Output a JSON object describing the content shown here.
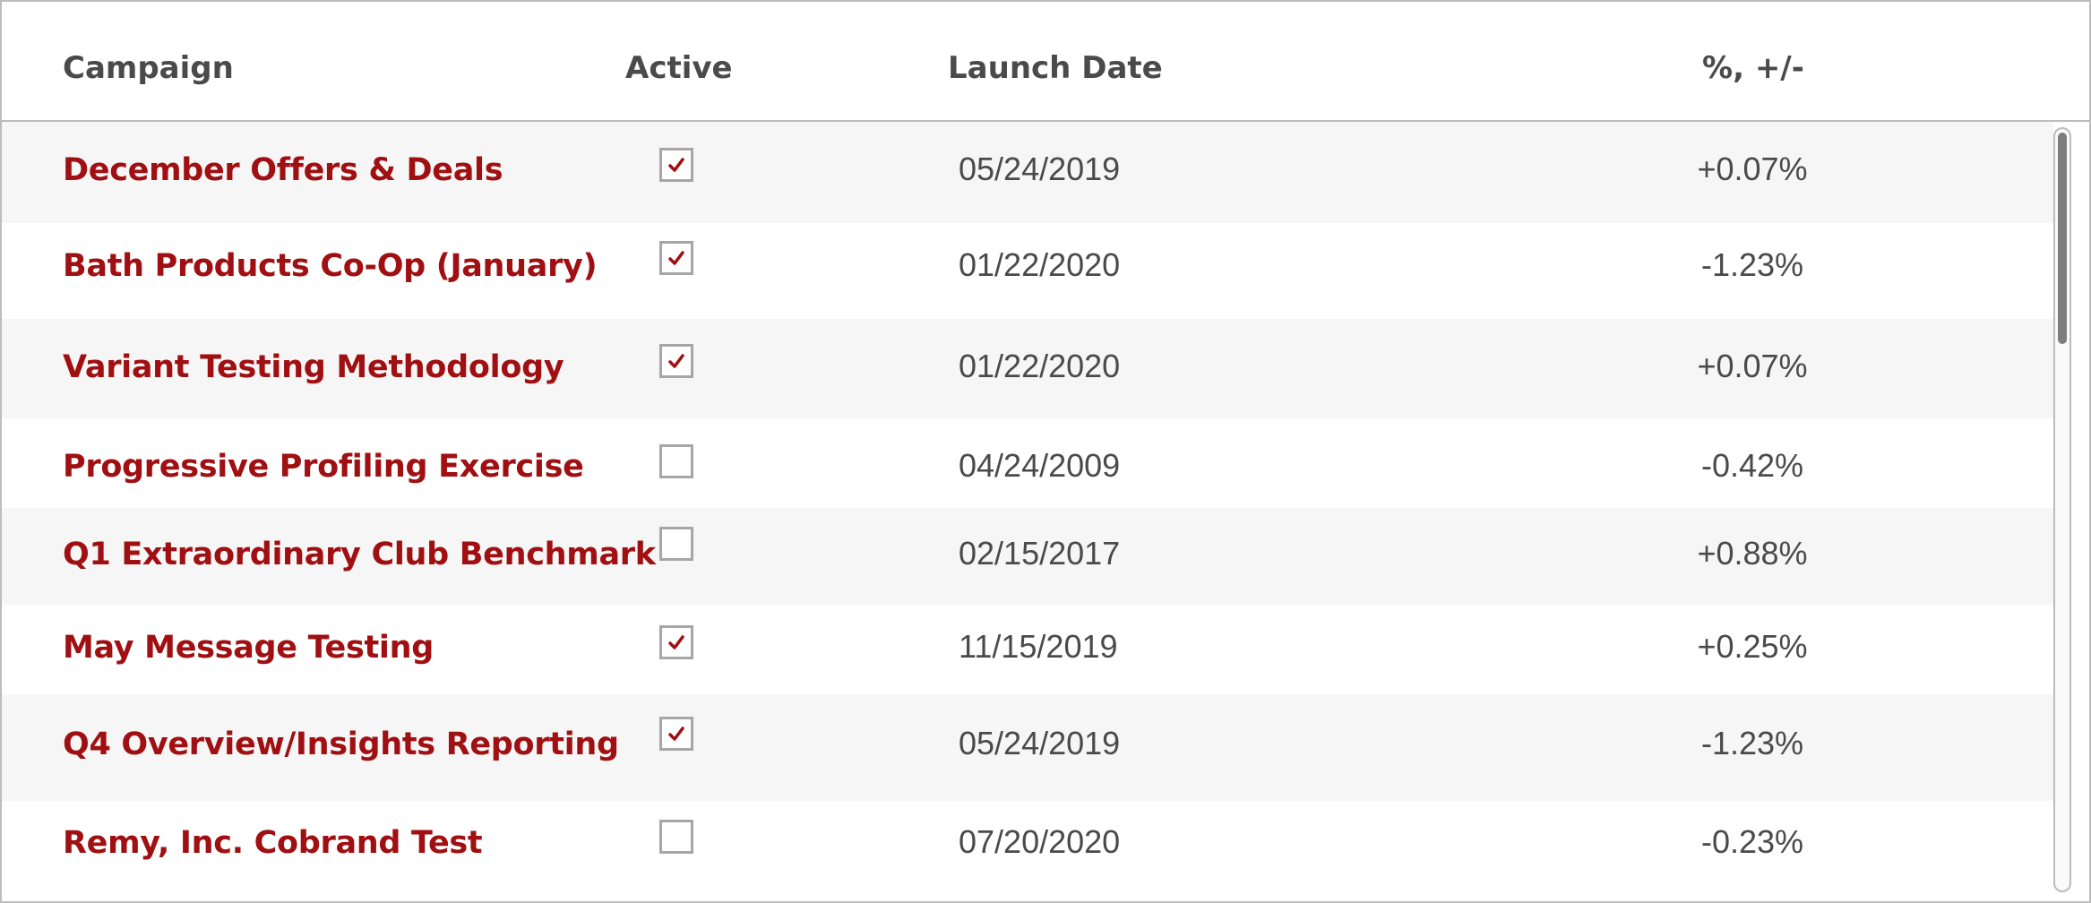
{
  "columns": {
    "campaign": "Campaign",
    "active": "Active",
    "launch_date": "Launch Date",
    "change": "%, +/-"
  },
  "colors": {
    "campaign_name": "#a00f12",
    "checkmark": "#a00f12",
    "text": "#4a4a4a",
    "row_alt": "#f6f6f6"
  },
  "rows": [
    {
      "name": "December Offers & Deals",
      "active": true,
      "date": "05/24/2019",
      "change": "+0.07%"
    },
    {
      "name": "Bath Products Co-Op (January)",
      "active": true,
      "date": "01/22/2020",
      "change": "-1.23%"
    },
    {
      "name": "Variant Testing Methodology",
      "active": true,
      "date": "01/22/2020",
      "change": "+0.07%"
    },
    {
      "name": "Progressive Profiling Exercise",
      "active": false,
      "date": "04/24/2009",
      "change": "-0.42%"
    },
    {
      "name": "Q1 Extraordinary Club Benchmark",
      "active": false,
      "date": "02/15/2017",
      "change": "+0.88%"
    },
    {
      "name": "May Message Testing",
      "active": true,
      "date": "11/15/2019",
      "change": "+0.25%"
    },
    {
      "name": "Q4 Overview/Insights Reporting",
      "active": true,
      "date": "05/24/2019",
      "change": "-1.23%"
    },
    {
      "name": "Remy, Inc. Cobrand Test",
      "active": false,
      "date": "07/20/2020",
      "change": "-0.23%"
    }
  ]
}
